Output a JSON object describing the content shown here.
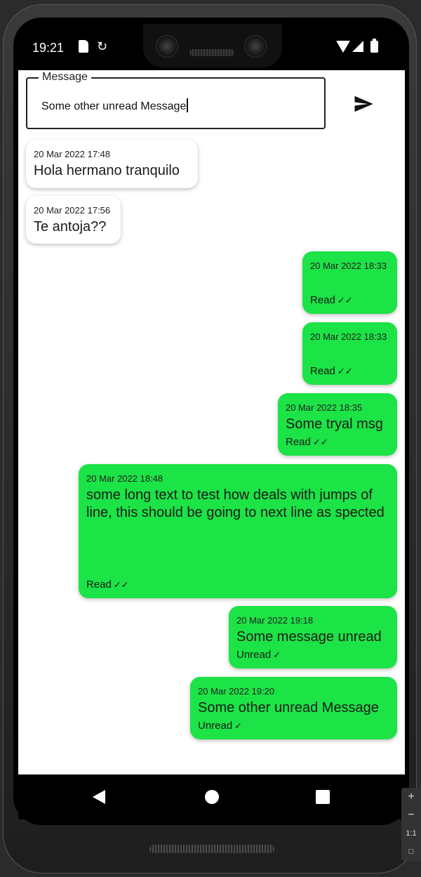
{
  "status_bar": {
    "time": "19:21",
    "icons": [
      "sd-card-icon",
      "sync-icon",
      "wifi-icon",
      "signal-icon",
      "battery-icon"
    ]
  },
  "input": {
    "label": "Message",
    "value": "Some other unread Message",
    "send_icon": "send-icon"
  },
  "messages": [
    {
      "direction": "incoming",
      "timestamp": "20 Mar 2022 17:48",
      "text": "Hola hermano tranquilo"
    },
    {
      "direction": "incoming",
      "timestamp": "20 Mar 2022 17:56",
      "text": "Te antoja??"
    },
    {
      "direction": "outgoing",
      "timestamp": "20 Mar 2022 18:33",
      "text": "",
      "status": "Read",
      "checks": "✓✓"
    },
    {
      "direction": "outgoing",
      "timestamp": "20 Mar 2022 18:33",
      "text": "",
      "status": "Read",
      "checks": "✓✓"
    },
    {
      "direction": "outgoing",
      "timestamp": "20 Mar 2022 18:35",
      "text": "Some tryal msg",
      "status": "Read",
      "checks": "✓✓"
    },
    {
      "direction": "outgoing",
      "timestamp": "20 Mar 2022 18:48",
      "text": "some long text to test how deals with jumps of line, this should be going to next line as spected",
      "status": "Read",
      "checks": "✓✓"
    },
    {
      "direction": "outgoing",
      "timestamp": "20 Mar 2022 19:18",
      "text": "Some message unread",
      "status": "Unread",
      "checks": "✓"
    },
    {
      "direction": "outgoing",
      "timestamp": "20 Mar 2022 19:20",
      "text": "Some other unread Message",
      "status": "Unread",
      "checks": "✓"
    }
  ],
  "nav": {
    "icons": [
      "back-icon",
      "home-icon",
      "recents-icon"
    ]
  },
  "zoom_panel": {
    "items": [
      "+",
      "−",
      "1:1"
    ]
  },
  "colors": {
    "outgoing_bubble": "#1ce346",
    "incoming_bubble": "#ffffff",
    "screen_bg": "#ffffff"
  }
}
